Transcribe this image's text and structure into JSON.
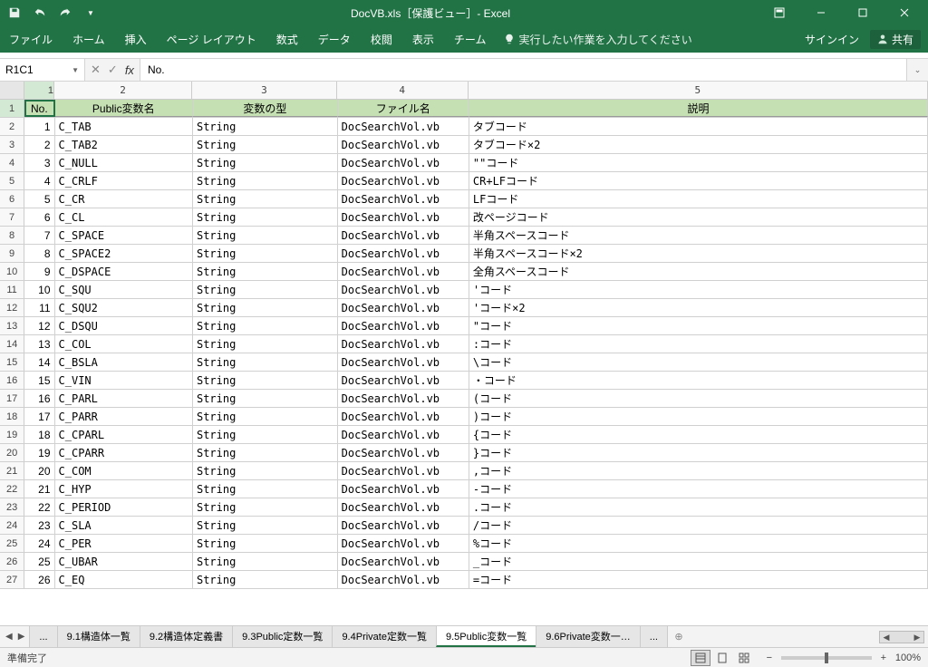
{
  "titlebar": {
    "title": "DocVB.xls［保護ビュー］- Excel"
  },
  "ribbon": {
    "tabs": [
      "ファイル",
      "ホーム",
      "挿入",
      "ページ レイアウト",
      "数式",
      "データ",
      "校閲",
      "表示",
      "チーム"
    ],
    "tellme": "実行したい作業を入力してください",
    "signin": "サインイン",
    "share": "共有"
  },
  "formula": {
    "namebox": "R1C1",
    "content": "No."
  },
  "columns": {
    "labels": [
      "1",
      "2",
      "3",
      "4",
      "5"
    ]
  },
  "table": {
    "headers": [
      "No.",
      "Public変数名",
      "変数の型",
      "ファイル名",
      "説明"
    ],
    "rows": [
      {
        "n": "1",
        "no": "1",
        "name": "C_TAB",
        "type": "String",
        "file": "DocSearchVol.vb",
        "desc": "タブコード"
      },
      {
        "n": "2",
        "no": "2",
        "name": "C_TAB2",
        "type": "String",
        "file": "DocSearchVol.vb",
        "desc": "タブコード×2"
      },
      {
        "n": "3",
        "no": "3",
        "name": "C_NULL",
        "type": "String",
        "file": "DocSearchVol.vb",
        "desc": "\"\"コード"
      },
      {
        "n": "4",
        "no": "4",
        "name": "C_CRLF",
        "type": "String",
        "file": "DocSearchVol.vb",
        "desc": "CR+LFコード"
      },
      {
        "n": "5",
        "no": "5",
        "name": "C_CR",
        "type": "String",
        "file": "DocSearchVol.vb",
        "desc": "LFコード"
      },
      {
        "n": "6",
        "no": "6",
        "name": "C_CL",
        "type": "String",
        "file": "DocSearchVol.vb",
        "desc": "改ページコード"
      },
      {
        "n": "7",
        "no": "7",
        "name": "C_SPACE",
        "type": "String",
        "file": "DocSearchVol.vb",
        "desc": "半角スペースコード"
      },
      {
        "n": "8",
        "no": "8",
        "name": "C_SPACE2",
        "type": "String",
        "file": "DocSearchVol.vb",
        "desc": "半角スペースコード×2"
      },
      {
        "n": "9",
        "no": "9",
        "name": "C_DSPACE",
        "type": "String",
        "file": "DocSearchVol.vb",
        "desc": "全角スペースコード"
      },
      {
        "n": "10",
        "no": "10",
        "name": "C_SQU",
        "type": "String",
        "file": "DocSearchVol.vb",
        "desc": "'コード"
      },
      {
        "n": "11",
        "no": "11",
        "name": "C_SQU2",
        "type": "String",
        "file": "DocSearchVol.vb",
        "desc": "'コード×2"
      },
      {
        "n": "12",
        "no": "12",
        "name": "C_DSQU",
        "type": "String",
        "file": "DocSearchVol.vb",
        "desc": "\"コード"
      },
      {
        "n": "13",
        "no": "13",
        "name": "C_COL",
        "type": "String",
        "file": "DocSearchVol.vb",
        "desc": ":コード"
      },
      {
        "n": "14",
        "no": "14",
        "name": "C_BSLA",
        "type": "String",
        "file": "DocSearchVol.vb",
        "desc": "\\コード"
      },
      {
        "n": "15",
        "no": "15",
        "name": "C_VIN",
        "type": "String",
        "file": "DocSearchVol.vb",
        "desc": "・コード"
      },
      {
        "n": "16",
        "no": "16",
        "name": "C_PARL",
        "type": "String",
        "file": "DocSearchVol.vb",
        "desc": "(コード"
      },
      {
        "n": "17",
        "no": "17",
        "name": "C_PARR",
        "type": "String",
        "file": "DocSearchVol.vb",
        "desc": ")コード"
      },
      {
        "n": "18",
        "no": "18",
        "name": "C_CPARL",
        "type": "String",
        "file": "DocSearchVol.vb",
        "desc": "{コード"
      },
      {
        "n": "19",
        "no": "19",
        "name": "C_CPARR",
        "type": "String",
        "file": "DocSearchVol.vb",
        "desc": "}コード"
      },
      {
        "n": "20",
        "no": "20",
        "name": "C_COM",
        "type": "String",
        "file": "DocSearchVol.vb",
        "desc": ",コード"
      },
      {
        "n": "21",
        "no": "21",
        "name": "C_HYP",
        "type": "String",
        "file": "DocSearchVol.vb",
        "desc": " -コード"
      },
      {
        "n": "22",
        "no": "22",
        "name": "C_PERIOD",
        "type": "String",
        "file": "DocSearchVol.vb",
        "desc": ".コード"
      },
      {
        "n": "23",
        "no": "23",
        "name": "C_SLA",
        "type": "String",
        "file": "DocSearchVol.vb",
        "desc": "/コード"
      },
      {
        "n": "24",
        "no": "24",
        "name": "C_PER",
        "type": "String",
        "file": "DocSearchVol.vb",
        "desc": "%コード"
      },
      {
        "n": "25",
        "no": "25",
        "name": "C_UBAR",
        "type": "String",
        "file": "DocSearchVol.vb",
        "desc": "_コード"
      },
      {
        "n": "26",
        "no": "26",
        "name": "C_EQ",
        "type": "String",
        "file": "DocSearchVol.vb",
        "desc": " =コード"
      }
    ]
  },
  "sheets": {
    "ellipsis_left": "...",
    "tabs": [
      "9.1構造体一覧",
      "9.2構造体定義書",
      "9.3Public定数一覧",
      "9.4Private定数一覧",
      "9.5Public変数一覧",
      "9.6Private変数一…"
    ],
    "active_index": 4,
    "ellipsis_right": "..."
  },
  "statusbar": {
    "status": "準備完了",
    "zoom": "100%"
  }
}
